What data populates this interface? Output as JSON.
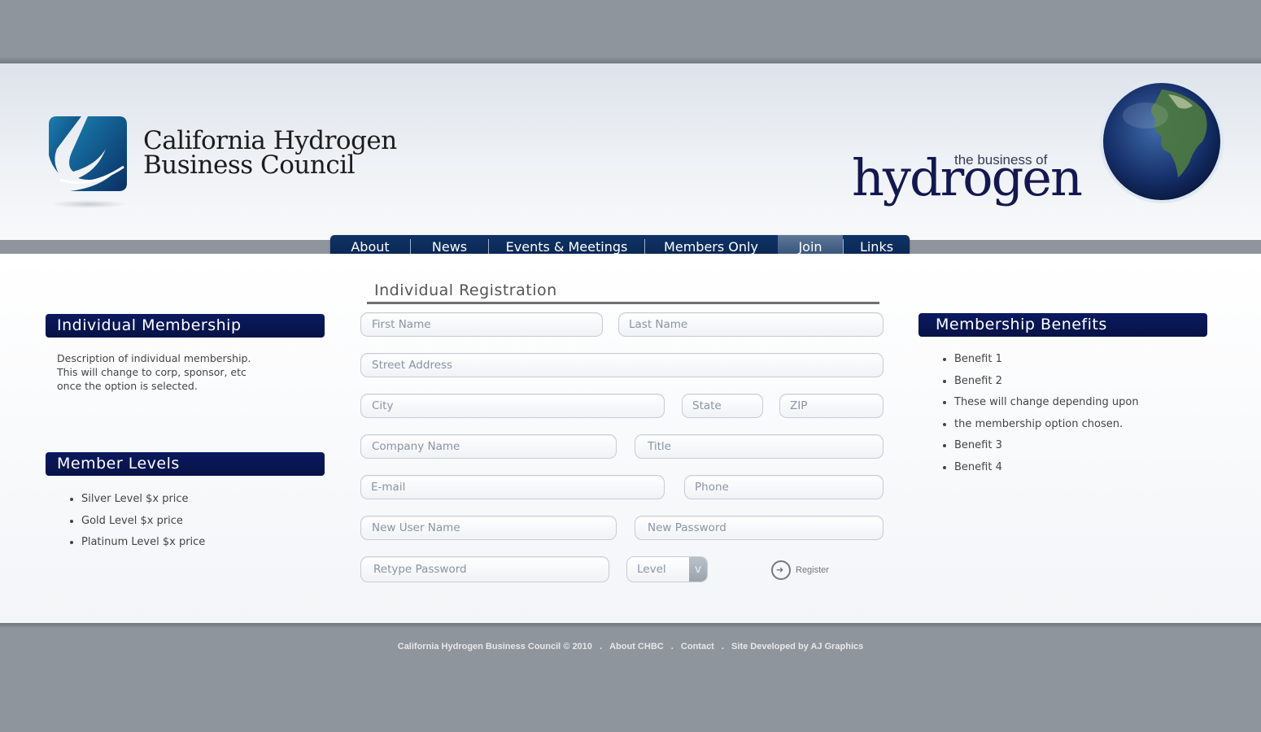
{
  "header": {
    "org_line1": "California Hydrogen",
    "org_line2": "Business Council",
    "tag_small": "the business of",
    "tag_big": "hydrogen"
  },
  "nav": {
    "items": [
      {
        "label": "About"
      },
      {
        "label": "News"
      },
      {
        "label": "Events & Meetings"
      },
      {
        "label": "Members Only"
      },
      {
        "label": "Join"
      },
      {
        "label": "Links"
      }
    ],
    "active": "Join"
  },
  "left": {
    "membership_title": "Individual Membership",
    "membership_desc_1": "Description of individual membership.",
    "membership_desc_2": "This will change to corp, sponsor, etc",
    "membership_desc_3": "once the option is selected.",
    "levels_title": "Member Levels",
    "levels": [
      "Silver Level $x price",
      "Gold Level $x price",
      "Platinum Level $x price"
    ]
  },
  "form": {
    "title": "Individual Registration",
    "first_name": "First Name",
    "last_name": "Last Name",
    "street": "Street Address",
    "city": "City",
    "state": "State",
    "zip": "ZIP",
    "company": "Company Name",
    "title_field": "Title",
    "email": "E-mail",
    "phone": "Phone",
    "username": "New User Name",
    "password": "New Password",
    "retype": "Retype Password",
    "level": "Level",
    "register": "Register"
  },
  "right": {
    "benefits_title": "Membership Benefits",
    "benefits": [
      "Benefit 1",
      "Benefit 2",
      "These will change depending upon",
      "the membership option chosen.",
      "Benefit 3",
      "Benefit 4"
    ]
  },
  "footer": {
    "copyright": "California Hydrogen Business Council © 2010",
    "about": "About CHBC",
    "contact": "Contact",
    "developer": "Site Developed by AJ Graphics",
    "sep": "."
  },
  "colors": {
    "nav_bg": "#0a2550",
    "box_header_bg": "#0b1a60",
    "page_bg": "#8f959c",
    "brand_text": "#14184f"
  }
}
